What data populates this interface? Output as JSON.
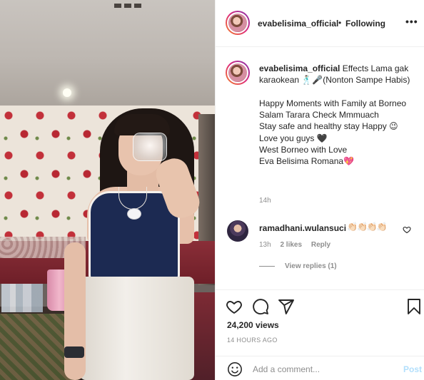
{
  "post": {
    "author": "evabelisima_official",
    "follow_separator": "•",
    "follow_status": "Following",
    "more_label": "•••"
  },
  "caption": {
    "author": "evabelisima_official",
    "lines": [
      "Effects Lama gak karaokean 🕺🏻🎤(Nonton Sampe Habis)",
      "",
      "Happy Moments with Family at Borneo",
      "Salam Tarara Check Mmmuach",
      "Stay safe and healthy stay Happy 😉",
      "Love you guys 🖤",
      "West Borneo with Love",
      "Eva Belisima Romana💖"
    ],
    "time": "14h"
  },
  "comments": [
    {
      "user": "ramadhani.wulansuci",
      "text": "👏🏻👏🏻👏🏻👏🏻",
      "time": "13h",
      "likes": "2 likes",
      "reply_label": "Reply",
      "view_replies": "View replies (1)"
    }
  ],
  "actions": {
    "like_icon": "heart-icon",
    "comment_icon": "comment-icon",
    "share_icon": "share-icon",
    "save_icon": "bookmark-icon",
    "views": "24,200 views",
    "timestamp": "14 HOURS AGO"
  },
  "add_comment": {
    "placeholder": "Add a comment...",
    "post_label": "Post",
    "emoji_icon": "smile-icon"
  },
  "colors": {
    "text": "#262626",
    "muted": "#8e8e8e",
    "post_disabled": "#b2dffc",
    "border": "#efefef"
  }
}
